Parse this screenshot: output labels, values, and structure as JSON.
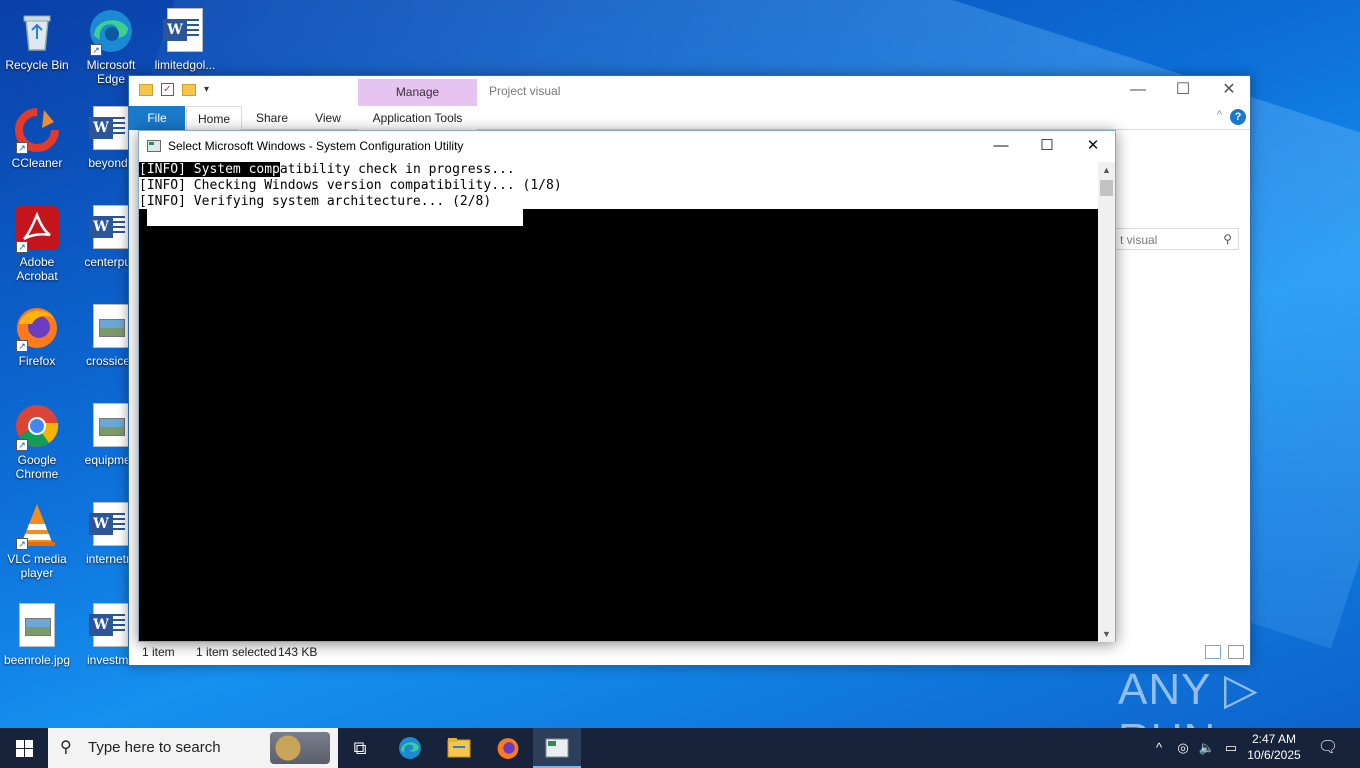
{
  "desktop": {
    "icons": [
      {
        "label": "Recycle Bin",
        "icon": "recycle-bin-icon"
      },
      {
        "label": "Microsoft Edge",
        "icon": "edge-icon"
      },
      {
        "label": "limitedgol...",
        "icon": "word-document-icon"
      },
      {
        "label": "CCleaner",
        "icon": "ccleaner-icon"
      },
      {
        "label": "beyondfl",
        "icon": "word-document-icon"
      },
      {
        "label": "Adobe Acrobat",
        "icon": "acrobat-icon"
      },
      {
        "label": "centerpub",
        "icon": "word-document-icon"
      },
      {
        "label": "Firefox",
        "icon": "firefox-icon"
      },
      {
        "label": "crossice.j",
        "icon": "image-file-icon"
      },
      {
        "label": "Google Chrome",
        "icon": "chrome-icon"
      },
      {
        "label": "equipmen",
        "icon": "image-file-icon"
      },
      {
        "label": "VLC media player",
        "icon": "vlc-icon"
      },
      {
        "label": "internetm",
        "icon": "word-document-icon"
      },
      {
        "label": "beenrole.jpg",
        "icon": "image-file-icon"
      },
      {
        "label": "investme",
        "icon": "word-document-icon"
      }
    ]
  },
  "explorer": {
    "manage_tab": "Manage",
    "window_name": "Project visual",
    "tabs": {
      "file": "File",
      "home": "Home",
      "share": "Share",
      "view": "View",
      "app_tools": "Application Tools"
    },
    "search_placeholder": "t visual",
    "status": {
      "count": "1 item",
      "selected": "1 item selected",
      "size": "143 KB"
    },
    "controls": {
      "minimize": "—",
      "maximize": "☐",
      "close": "✕",
      "help": "?",
      "collapse": "^"
    }
  },
  "console": {
    "title": "Select Microsoft Windows - System Configuration Utility",
    "line1_selected": "[INFO] System comp",
    "line1_rest": "atibility check in progress...",
    "line2": "[INFO] Checking Windows version compatibility... (1/8)",
    "line3": "[INFO] Verifying system architecture... (2/8)",
    "controls": {
      "minimize": "—",
      "maximize": "☐",
      "close": "✕"
    }
  },
  "watermark": "ANY ▷ RUN",
  "taskbar": {
    "search_placeholder": "Type here to search",
    "time": "2:47 AM",
    "date": "10/6/2025",
    "colors": {
      "bar": "#16233a",
      "accent": "#76b9ed"
    }
  }
}
